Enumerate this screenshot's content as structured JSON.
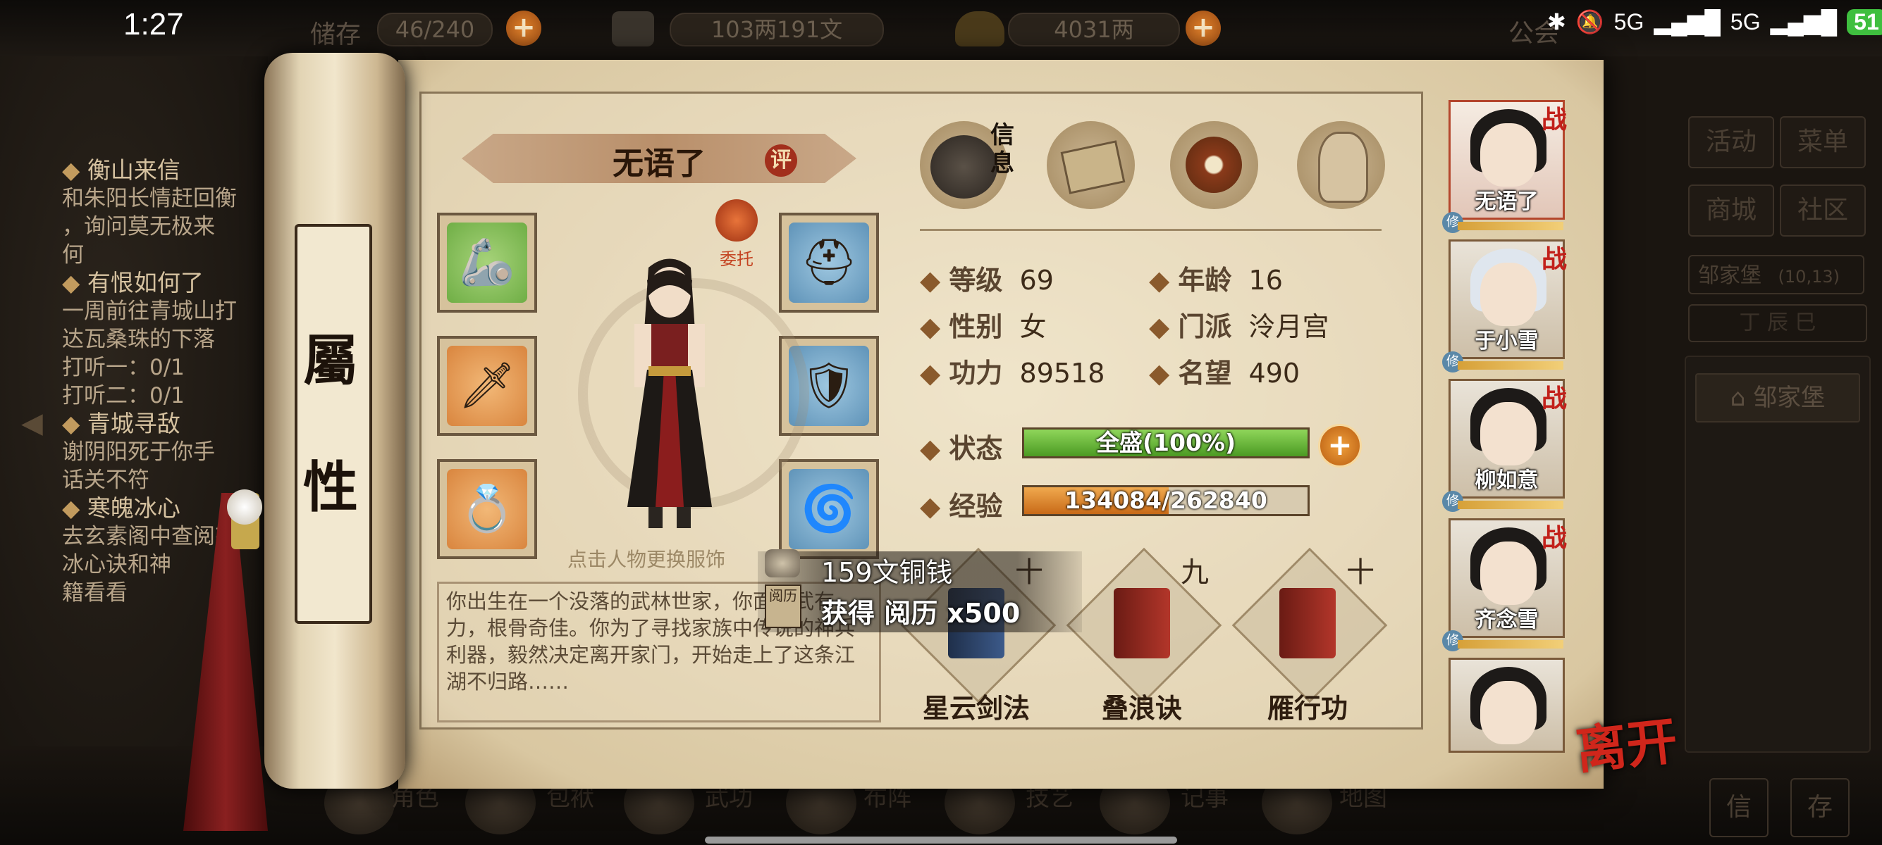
{
  "status_bar": {
    "time": "1:27",
    "network1": "5G",
    "network2": "5G",
    "battery": "51"
  },
  "top_resources": {
    "bag_label": "储存",
    "bag_count": "46/240",
    "copper": "103两191文",
    "silver": "4031两",
    "announce": "公会"
  },
  "quest_log": [
    {
      "title": "衡山来信",
      "lines": [
        "和朱阳长情赶回衡",
        "，询问莫无极来",
        "何"
      ]
    },
    {
      "title": "有恨如何了",
      "lines": [
        "一周前往青城山打",
        "达瓦桑珠的下落",
        "打听一：0/1",
        "打听二：0/1"
      ]
    },
    {
      "title": "青城寻敌",
      "lines": [
        "谢阴阳死于你手",
        "话关不符"
      ]
    },
    {
      "title": "寒魄冰心",
      "lines": [
        "去玄素阁中查阅有",
        "冰心诀和神",
        "籍看看"
      ]
    }
  ],
  "right_menu": {
    "activity": "活动",
    "menu": "菜单",
    "shop": "商城",
    "community": "社区",
    "location": "邹家堡",
    "coords": "(10,13)",
    "date": "丁 辰 巳",
    "location_button": "邹家堡",
    "letter": "信",
    "save": "存"
  },
  "scroll": {
    "label_top": "屬",
    "label_bottom": "性"
  },
  "character": {
    "name": "无语了",
    "eval": "评",
    "entrust": "委托",
    "hint": "点击人物更换服饰",
    "description": "你出生在一个没落的武林世家，你面孔武有力，根骨奇佳。你为了寻找家族中传说的神兵利器，毅然决定离开家门，开始走上了这条江湖不归路……"
  },
  "tabs": {
    "info": "信息"
  },
  "stats": {
    "level_label": "等级",
    "level": "69",
    "age_label": "年龄",
    "age": "16",
    "gender_label": "性别",
    "gender": "女",
    "sect_label": "门派",
    "sect": "泠月宫",
    "power_label": "功力",
    "power": "89518",
    "fame_label": "名望",
    "fame": "490",
    "state_label": "状态",
    "state": "全盛(100%)",
    "state_fraction": 1.0,
    "exp_label": "经验",
    "exp": "134084/262840",
    "exp_fraction": 0.51
  },
  "popup": {
    "coins": "159文铜钱",
    "gain": "获得 阅历 x500",
    "book_label": "阅历"
  },
  "skills": [
    {
      "name": "星云剑法",
      "rank": "十"
    },
    {
      "name": "叠浪诀",
      "rank": "九"
    },
    {
      "name": "雁行功",
      "rank": "十"
    }
  ],
  "party": [
    {
      "name": "无语了",
      "badge": "战",
      "cultivate": "修"
    },
    {
      "name": "于小雪",
      "badge": "战",
      "cultivate": "修"
    },
    {
      "name": "柳如意",
      "badge": "战",
      "cultivate": "修"
    },
    {
      "name": "齐念雪",
      "badge": "战",
      "cultivate": "修"
    },
    {
      "name": "",
      "badge": "",
      "cultivate": ""
    }
  ],
  "leave_button": "离开",
  "bottom_nav": [
    "角色",
    "包袱",
    "武功",
    "布阵",
    "技艺",
    "记事",
    "地图"
  ],
  "colors": {
    "paper": "#e8dcbf",
    "state_bar": "#6fbf3a",
    "exp_bar": "#d9862e",
    "accent_red": "#c2201a"
  }
}
